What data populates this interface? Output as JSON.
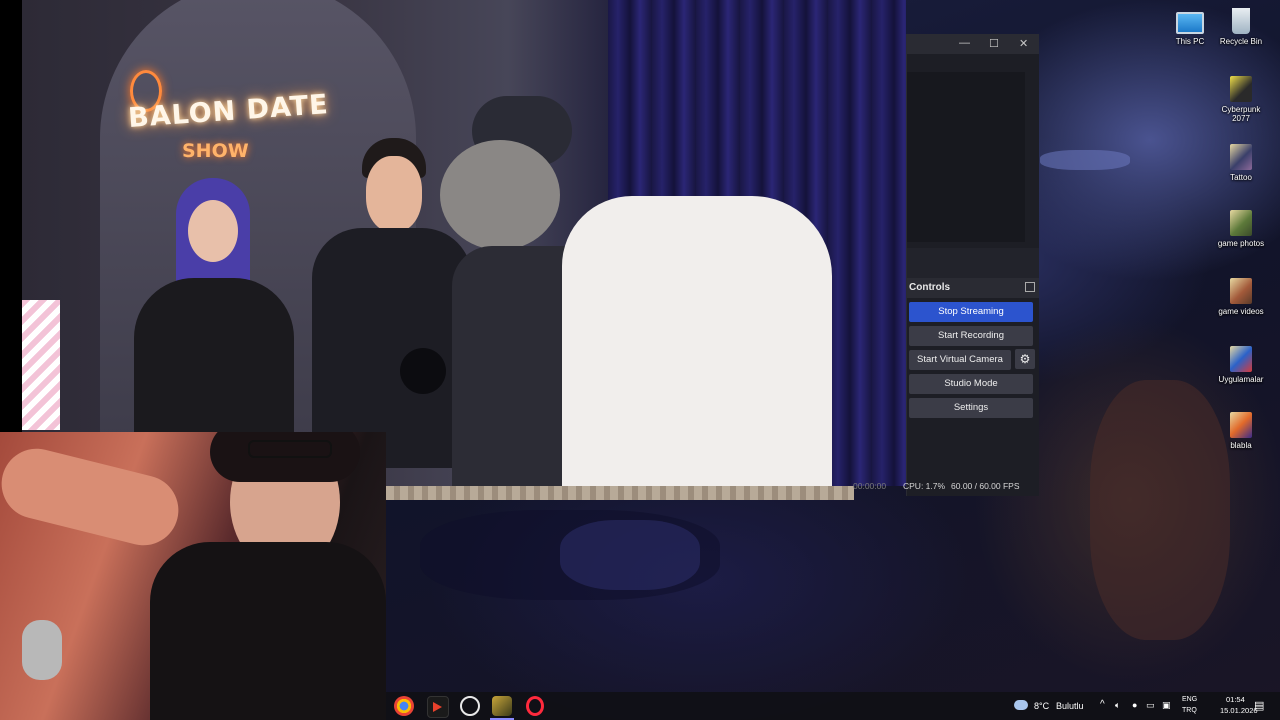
{
  "video": {
    "neon_title": "BALON DATE",
    "neon_subtitle": "SHOW"
  },
  "obs": {
    "window_controls": {
      "minimize": "—",
      "maximize": "☐",
      "close": "✕"
    },
    "dock_title": "Controls",
    "buttons": {
      "stop_streaming": "Stop Streaming",
      "start_recording": "Start Recording",
      "start_virtual_camera": "Start Virtual Camera",
      "studio_mode": "Studio Mode",
      "settings": "Settings"
    },
    "status": {
      "timer": "00:00:00",
      "cpu": "CPU: 1.7%",
      "fps": "60.00 / 60.00 FPS"
    },
    "accent_color": "#2c54ce"
  },
  "desktop_icons": [
    {
      "label": "This PC",
      "icon": "computer-icon"
    },
    {
      "label": "Recycle Bin",
      "icon": "recycle-bin-icon"
    },
    {
      "label": "Cyberpunk 2077",
      "icon": "game-shortcut-icon"
    },
    {
      "label": "Tattoo",
      "icon": "folder-icon"
    },
    {
      "label": "game photos",
      "icon": "folder-icon"
    },
    {
      "label": "game videos",
      "icon": "folder-icon"
    },
    {
      "label": "Uygulamalar",
      "icon": "folder-icon"
    },
    {
      "label": "blabla",
      "icon": "folder-icon"
    }
  ],
  "taskbar": {
    "apps": [
      "chrome-icon",
      "stream-app-icon",
      "obs-icon",
      "game-icon",
      "opera-icon"
    ],
    "weather": {
      "temp": "8°C",
      "condition": "Bulutlu"
    },
    "language": {
      "lang": "ENG",
      "layout": "TRQ"
    },
    "clock": {
      "time": "01:54",
      "date": "15.01.2026"
    }
  }
}
